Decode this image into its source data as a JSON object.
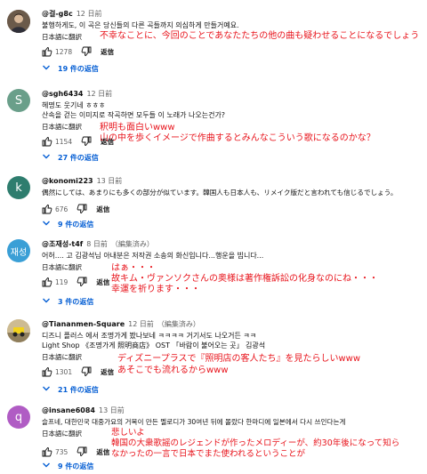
{
  "ui": {
    "translate_label": "日本語に翻訳",
    "reply_label": "返信"
  },
  "colors": {
    "link_blue": "#065fd4",
    "annotation_red": "#e8141c",
    "avatar_s": "#6a9f8a",
    "avatar_k": "#2e7d6e",
    "avatar_jae": "#3a9fd6",
    "avatar_q": "#b05cc4"
  },
  "comments": [
    {
      "handle": "@걸-g8c",
      "time": "12 日前",
      "edited": "",
      "avatar_icon": "profile-photo",
      "text_lines": [
        "불행하게도, 이 곡은 당신들의 다른 곡들까지 의심하게 만들거예요."
      ],
      "annotation": [
        "不幸なことに、今回のことであなたたちの他の曲も疑わせることになるでしょう"
      ],
      "likes": "1278",
      "replies": "19 件の返信"
    },
    {
      "handle": "@sgh6434",
      "time": "12 日前",
      "edited": "",
      "avatar_letter": "S",
      "text_lines": [
        "헤명도 웃기네 ㅎㅎㅎ",
        "산속을 걷는 이미지로 작곡하면 모두들 이 노래가 나오는건가?"
      ],
      "annotation": [
        "釈明も面白いwww",
        "山の中を歩くイメージで作曲するとみんなこういう歌になるのかな？"
      ],
      "likes": "1154",
      "replies": "27 件の返信"
    },
    {
      "handle": "@konomi223",
      "time": "13 日前",
      "edited": "",
      "avatar_letter": "k",
      "text_lines": [
        "偶然にしては、あまりにも多くの部分が似ています。韓国人も日本人も、リメイク版だと言われても信じるでしょう。"
      ],
      "annotation": [],
      "likes": "676",
      "replies": "9 件の返信"
    },
    {
      "handle": "@조재성-t4f",
      "time": "8 日前",
      "edited": "（編集済み）",
      "avatar_letter": "재성",
      "text_lines": [
        "어허.... 고 김광석님 아내분은 저작권 소송의 화신입니다...행운을 빕니다..."
      ],
      "annotation": [
        "はぁ・・・",
        "故キム・ヴァンソクさんの奥様は著作権訴訟の化身なのにね・・・",
        "幸運を祈ります・・・"
      ],
      "likes": "119",
      "replies": "3 件の返信"
    },
    {
      "handle": "@Tiananmen-Square",
      "time": "12 日前",
      "edited": "（編集済み）",
      "avatar_icon": "profile-photo",
      "text_lines": [
        "디즈니 플러스 에서 조명가게 봤나보네 ㅋㅋㅋㅋ 거기서도 나오거든 ㅋㅋ",
        "Light Shop 《조명가게 照明商店》 OST 「바람이 불어오는 곳」 김광석"
      ],
      "annotation": [
        "ディズニープラスで『照明店の客人たち』を見たらしいwww",
        "あそこでも流れるからwww"
      ],
      "likes": "1301",
      "replies": "21 件の返信"
    },
    {
      "handle": "@insane6084",
      "time": "13 日前",
      "edited": "",
      "avatar_letter": "q",
      "text_lines": [
        "슬프네, 대한민국 대중가요의 거목이 만든 멜로디가 30여년 뒤에 몰랐다 한마디에 일본에서 다시 쓰인다는게"
      ],
      "annotation": [
        "悲しいよ",
        "韓国の大衆歌謡のレジェンドが作ったメロディーが、約30年後になって知ら",
        "なかったの一言で日本でまた使われるということが"
      ],
      "likes": "735",
      "replies": "9 件の返信"
    }
  ]
}
